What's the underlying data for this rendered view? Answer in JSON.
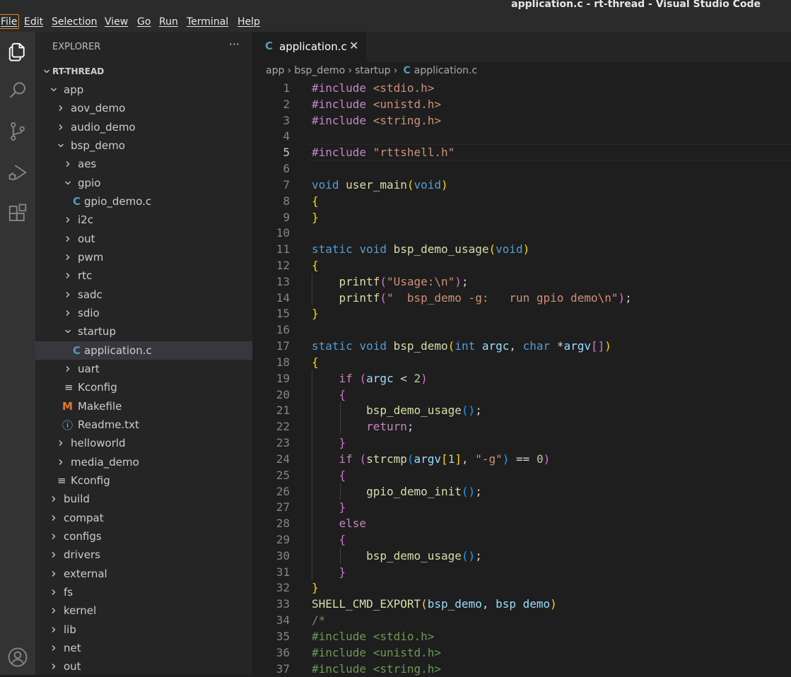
{
  "window": {
    "title": "application.c - rt-thread - Visual Studio Code"
  },
  "menu": [
    "File",
    "Edit",
    "Selection",
    "View",
    "Go",
    "Run",
    "Terminal",
    "Help"
  ],
  "activity_bar": [
    "files-icon",
    "search-icon",
    "source-control-icon",
    "run-debug-icon",
    "extensions-icon",
    "account-icon"
  ],
  "explorer": {
    "header": "EXPLORER",
    "more": "···",
    "root": "RT-THREAD",
    "tree": [
      {
        "label": "app",
        "depth": 1,
        "type": "folder",
        "open": true
      },
      {
        "label": "aov_demo",
        "depth": 2,
        "type": "folder",
        "open": false
      },
      {
        "label": "audio_demo",
        "depth": 2,
        "type": "folder",
        "open": false
      },
      {
        "label": "bsp_demo",
        "depth": 2,
        "type": "folder",
        "open": true
      },
      {
        "label": "aes",
        "depth": 3,
        "type": "folder",
        "open": false
      },
      {
        "label": "gpio",
        "depth": 3,
        "type": "folder",
        "open": true
      },
      {
        "label": "gpio_demo.c",
        "depth": 4,
        "type": "c-file"
      },
      {
        "label": "i2c",
        "depth": 3,
        "type": "folder",
        "open": false
      },
      {
        "label": "out",
        "depth": 3,
        "type": "folder",
        "open": false
      },
      {
        "label": "pwm",
        "depth": 3,
        "type": "folder",
        "open": false
      },
      {
        "label": "rtc",
        "depth": 3,
        "type": "folder",
        "open": false
      },
      {
        "label": "sadc",
        "depth": 3,
        "type": "folder",
        "open": false
      },
      {
        "label": "sdio",
        "depth": 3,
        "type": "folder",
        "open": false
      },
      {
        "label": "startup",
        "depth": 3,
        "type": "folder",
        "open": true
      },
      {
        "label": "application.c",
        "depth": 4,
        "type": "c-file",
        "selected": true
      },
      {
        "label": "uart",
        "depth": 3,
        "type": "folder",
        "open": false
      },
      {
        "label": "Kconfig",
        "depth": 3,
        "type": "kconfig-file"
      },
      {
        "label": "Makefile",
        "depth": 3,
        "type": "makefile"
      },
      {
        "label": "Readme.txt",
        "depth": 3,
        "type": "info-file"
      },
      {
        "label": "helloworld",
        "depth": 2,
        "type": "folder",
        "open": false
      },
      {
        "label": "media_demo",
        "depth": 2,
        "type": "folder",
        "open": false
      },
      {
        "label": "Kconfig",
        "depth": 2,
        "type": "kconfig-file"
      },
      {
        "label": "build",
        "depth": 1,
        "type": "folder",
        "open": false
      },
      {
        "label": "compat",
        "depth": 1,
        "type": "folder",
        "open": false
      },
      {
        "label": "configs",
        "depth": 1,
        "type": "folder",
        "open": false
      },
      {
        "label": "drivers",
        "depth": 1,
        "type": "folder",
        "open": false
      },
      {
        "label": "external",
        "depth": 1,
        "type": "folder",
        "open": false
      },
      {
        "label": "fs",
        "depth": 1,
        "type": "folder",
        "open": false
      },
      {
        "label": "kernel",
        "depth": 1,
        "type": "folder",
        "open": false
      },
      {
        "label": "lib",
        "depth": 1,
        "type": "folder",
        "open": false
      },
      {
        "label": "net",
        "depth": 1,
        "type": "folder",
        "open": false
      },
      {
        "label": "out",
        "depth": 1,
        "type": "folder",
        "open": false
      }
    ]
  },
  "editor": {
    "tab": {
      "icon": "C",
      "label": "application.c",
      "close": "✕"
    },
    "breadcrumb": [
      "app",
      "bsp_demo",
      "startup",
      "application.c"
    ],
    "breadcrumb_file_icon": "C",
    "active_line": 5,
    "lines": [
      {
        "n": "1",
        "tokens": [
          [
            "inc",
            "#include "
          ],
          [
            "str",
            "<stdio.h>"
          ]
        ]
      },
      {
        "n": "2",
        "tokens": [
          [
            "inc",
            "#include "
          ],
          [
            "str",
            "<unistd.h>"
          ]
        ]
      },
      {
        "n": "3",
        "tokens": [
          [
            "inc",
            "#include "
          ],
          [
            "str",
            "<string.h>"
          ]
        ]
      },
      {
        "n": "4",
        "tokens": []
      },
      {
        "n": "5",
        "tokens": [
          [
            "inc",
            "#include "
          ],
          [
            "str",
            "\"rttshell.h\""
          ]
        ]
      },
      {
        "n": "6",
        "tokens": []
      },
      {
        "n": "7",
        "tokens": [
          [
            "kw",
            "void"
          ],
          [
            "pl",
            " "
          ],
          [
            "fn",
            "user_main"
          ],
          [
            "b1",
            "("
          ],
          [
            "kw",
            "void"
          ],
          [
            "b1",
            ")"
          ]
        ]
      },
      {
        "n": "8",
        "tokens": [
          [
            "b1",
            "{"
          ]
        ]
      },
      {
        "n": "9",
        "tokens": [
          [
            "b1",
            "}"
          ]
        ]
      },
      {
        "n": "10",
        "tokens": []
      },
      {
        "n": "11",
        "tokens": [
          [
            "kw",
            "static"
          ],
          [
            "pl",
            " "
          ],
          [
            "kw",
            "void"
          ],
          [
            "pl",
            " "
          ],
          [
            "fn",
            "bsp_demo_usage"
          ],
          [
            "b1",
            "("
          ],
          [
            "kw",
            "void"
          ],
          [
            "b1",
            ")"
          ]
        ]
      },
      {
        "n": "12",
        "tokens": [
          [
            "b1",
            "{"
          ]
        ]
      },
      {
        "n": "13",
        "tokens": [
          [
            "pl",
            "    "
          ],
          [
            "fn",
            "printf"
          ],
          [
            "b2",
            "("
          ],
          [
            "str",
            "\"Usage:\\n\""
          ],
          [
            "b2",
            ")"
          ],
          [
            "pl",
            ";"
          ]
        ]
      },
      {
        "n": "14",
        "tokens": [
          [
            "pl",
            "    "
          ],
          [
            "fn",
            "printf"
          ],
          [
            "b2",
            "("
          ],
          [
            "str",
            "\"  bsp_demo -g:   run gpio demo\\n\""
          ],
          [
            "b2",
            ")"
          ],
          [
            "pl",
            ";"
          ]
        ]
      },
      {
        "n": "15",
        "tokens": [
          [
            "b1",
            "}"
          ]
        ]
      },
      {
        "n": "16",
        "tokens": []
      },
      {
        "n": "17",
        "tokens": [
          [
            "kw",
            "static"
          ],
          [
            "pl",
            " "
          ],
          [
            "kw",
            "void"
          ],
          [
            "pl",
            " "
          ],
          [
            "fn",
            "bsp_demo"
          ],
          [
            "b1",
            "("
          ],
          [
            "kw",
            "int"
          ],
          [
            "pl",
            " "
          ],
          [
            "var",
            "argc"
          ],
          [
            "pl",
            ", "
          ],
          [
            "kw",
            "char"
          ],
          [
            "pl",
            " *"
          ],
          [
            "var",
            "argv"
          ],
          [
            "b2",
            "[]"
          ],
          [
            "b1",
            ")"
          ]
        ]
      },
      {
        "n": "18",
        "tokens": [
          [
            "b1",
            "{"
          ]
        ]
      },
      {
        "n": "19",
        "tokens": [
          [
            "pl",
            "    "
          ],
          [
            "ctl",
            "if"
          ],
          [
            "pl",
            " "
          ],
          [
            "b2",
            "("
          ],
          [
            "var",
            "argc"
          ],
          [
            "pl",
            " < "
          ],
          [
            "num",
            "2"
          ],
          [
            "b2",
            ")"
          ]
        ]
      },
      {
        "n": "20",
        "tokens": [
          [
            "pl",
            "    "
          ],
          [
            "b2",
            "{"
          ]
        ]
      },
      {
        "n": "21",
        "tokens": [
          [
            "pl",
            "        "
          ],
          [
            "fn",
            "bsp_demo_usage"
          ],
          [
            "b3",
            "()"
          ],
          [
            "pl",
            ";"
          ]
        ]
      },
      {
        "n": "22",
        "tokens": [
          [
            "pl",
            "        "
          ],
          [
            "ctl",
            "return"
          ],
          [
            "pl",
            ";"
          ]
        ]
      },
      {
        "n": "23",
        "tokens": [
          [
            "pl",
            "    "
          ],
          [
            "b2",
            "}"
          ]
        ]
      },
      {
        "n": "24",
        "tokens": [
          [
            "pl",
            "    "
          ],
          [
            "ctl",
            "if"
          ],
          [
            "pl",
            " "
          ],
          [
            "b2",
            "("
          ],
          [
            "fn",
            "strcmp"
          ],
          [
            "b3",
            "("
          ],
          [
            "var",
            "argv"
          ],
          [
            "b1",
            "["
          ],
          [
            "num",
            "1"
          ],
          [
            "b1",
            "]"
          ],
          [
            "pl",
            ", "
          ],
          [
            "str",
            "\"-g\""
          ],
          [
            "b3",
            ")"
          ],
          [
            "pl",
            " == "
          ],
          [
            "num",
            "0"
          ],
          [
            "b2",
            ")"
          ]
        ]
      },
      {
        "n": "25",
        "tokens": [
          [
            "pl",
            "    "
          ],
          [
            "b2",
            "{"
          ]
        ]
      },
      {
        "n": "26",
        "tokens": [
          [
            "pl",
            "        "
          ],
          [
            "fn",
            "gpio_demo_init"
          ],
          [
            "b3",
            "()"
          ],
          [
            "pl",
            ";"
          ]
        ]
      },
      {
        "n": "27",
        "tokens": [
          [
            "pl",
            "    "
          ],
          [
            "b2",
            "}"
          ]
        ]
      },
      {
        "n": "28",
        "tokens": [
          [
            "pl",
            "    "
          ],
          [
            "ctl",
            "else"
          ]
        ]
      },
      {
        "n": "29",
        "tokens": [
          [
            "pl",
            "    "
          ],
          [
            "b2",
            "{"
          ]
        ]
      },
      {
        "n": "30",
        "tokens": [
          [
            "pl",
            "        "
          ],
          [
            "fn",
            "bsp_demo_usage"
          ],
          [
            "b3",
            "()"
          ],
          [
            "pl",
            ";"
          ]
        ]
      },
      {
        "n": "31",
        "tokens": [
          [
            "pl",
            "    "
          ],
          [
            "b2",
            "}"
          ]
        ]
      },
      {
        "n": "32",
        "tokens": [
          [
            "b1",
            "}"
          ]
        ]
      },
      {
        "n": "33",
        "tokens": [
          [
            "fn",
            "SHELL_CMD_EXPORT"
          ],
          [
            "b1",
            "("
          ],
          [
            "var",
            "bsp_demo"
          ],
          [
            "pl",
            ", "
          ],
          [
            "var",
            "bsp"
          ],
          [
            "pl",
            " "
          ],
          [
            "var",
            "demo"
          ],
          [
            "b1",
            ")"
          ]
        ]
      },
      {
        "n": "34",
        "tokens": [
          [
            "com",
            "/*"
          ]
        ]
      },
      {
        "n": "35",
        "tokens": [
          [
            "com",
            "#include <stdio.h>"
          ]
        ]
      },
      {
        "n": "36",
        "tokens": [
          [
            "com",
            "#include <unistd.h>"
          ]
        ]
      },
      {
        "n": "37",
        "tokens": [
          [
            "com",
            "#include <string.h>"
          ]
        ]
      }
    ]
  }
}
